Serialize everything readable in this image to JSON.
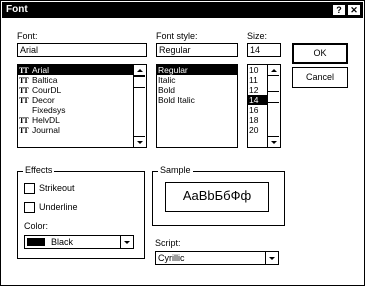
{
  "window": {
    "title": "Font",
    "help_label": "?",
    "close_label": "✕"
  },
  "font": {
    "label": "Font:",
    "value": "Arial",
    "items": [
      {
        "label": "Arial",
        "truetype": true,
        "selected": true
      },
      {
        "label": "Baltica",
        "truetype": true,
        "selected": false
      },
      {
        "label": "CourDL",
        "truetype": true,
        "selected": false
      },
      {
        "label": "Decor",
        "truetype": true,
        "selected": false
      },
      {
        "label": "Fixedsys",
        "truetype": false,
        "selected": false
      },
      {
        "label": "HelvDL",
        "truetype": true,
        "selected": false
      },
      {
        "label": "Journal",
        "truetype": true,
        "selected": false
      }
    ]
  },
  "style": {
    "label": "Font style:",
    "value": "Regular",
    "items": [
      {
        "label": "Regular",
        "selected": true
      },
      {
        "label": "Italic",
        "selected": false
      },
      {
        "label": "Bold",
        "selected": false
      },
      {
        "label": "Bold Italic",
        "selected": false
      }
    ]
  },
  "size": {
    "label": "Size:",
    "value": "14",
    "items": [
      {
        "label": "10",
        "selected": false
      },
      {
        "label": "11",
        "selected": false
      },
      {
        "label": "12",
        "selected": false
      },
      {
        "label": "14",
        "selected": true
      },
      {
        "label": "16",
        "selected": false
      },
      {
        "label": "18",
        "selected": false
      },
      {
        "label": "20",
        "selected": false
      }
    ]
  },
  "buttons": {
    "ok": "OK",
    "cancel": "Cancel"
  },
  "effects": {
    "label": "Effects",
    "strikeout": "Strikeout",
    "underline": "Underline",
    "color_label": "Color:",
    "color_value": "Black",
    "color_hex": "#000000"
  },
  "sample": {
    "label": "Sample",
    "text": "AaBbБбФф"
  },
  "script": {
    "label": "Script:",
    "value": "Cyrillic"
  },
  "icons": {
    "truetype": "TT-icon",
    "dropdown": "down-arrow"
  }
}
